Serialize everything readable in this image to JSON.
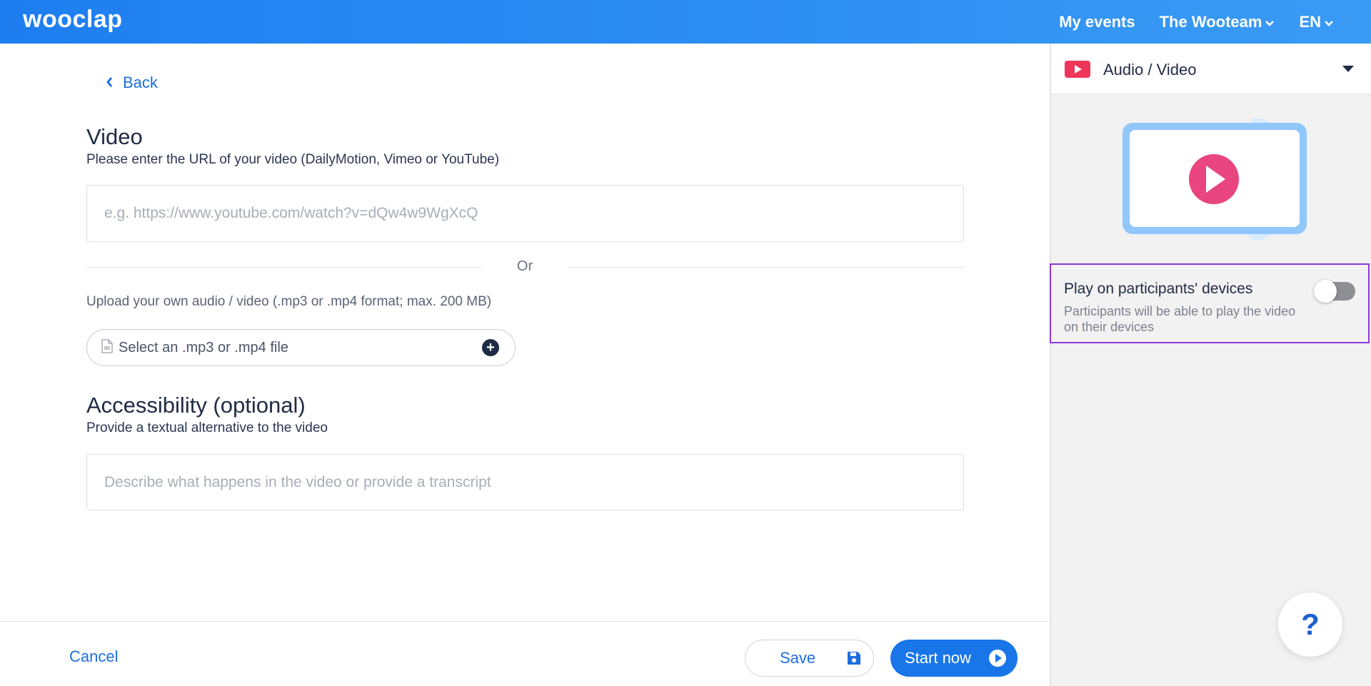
{
  "header": {
    "logo": "wooclap",
    "nav": [
      {
        "label": "My events"
      },
      {
        "label": "The Wooteam"
      },
      {
        "label": "EN"
      }
    ]
  },
  "editor": {
    "back_label": "Back",
    "video_title": "Video",
    "video_subtitle": "Please enter the URL of your video (DailyMotion, Vimeo or YouTube)",
    "url_value": "",
    "url_placeholder": "e.g. https://www.youtube.com/watch?v=dQw4w9WgXcQ",
    "or_label": "Or",
    "upload_label": "Upload your own audio / video (.mp3 or .mp4 format; max. 200 MB)",
    "file_select_label": "Select an .mp3 or .mp4 file",
    "accessibility_title": "Accessibility (optional)",
    "accessibility_subtitle": "Provide a textual alternative to the video",
    "description_value": "",
    "description_placeholder": "Describe what happens in the video or provide a transcript"
  },
  "footer": {
    "cancel_label": "Cancel",
    "save_label": "Save",
    "start_label": "Start now"
  },
  "panel": {
    "question_type": "Audio / Video",
    "option": {
      "title": "Play on participants' devices",
      "description": "Participants will be able to play the video on their devices",
      "enabled": false
    },
    "help_label": "?"
  },
  "colors": {
    "brand_blue": "#1e7ef0",
    "link_blue": "#1d6fe0",
    "highlight_purple": "#8a3ad8",
    "play_pink": "#e9457f"
  }
}
